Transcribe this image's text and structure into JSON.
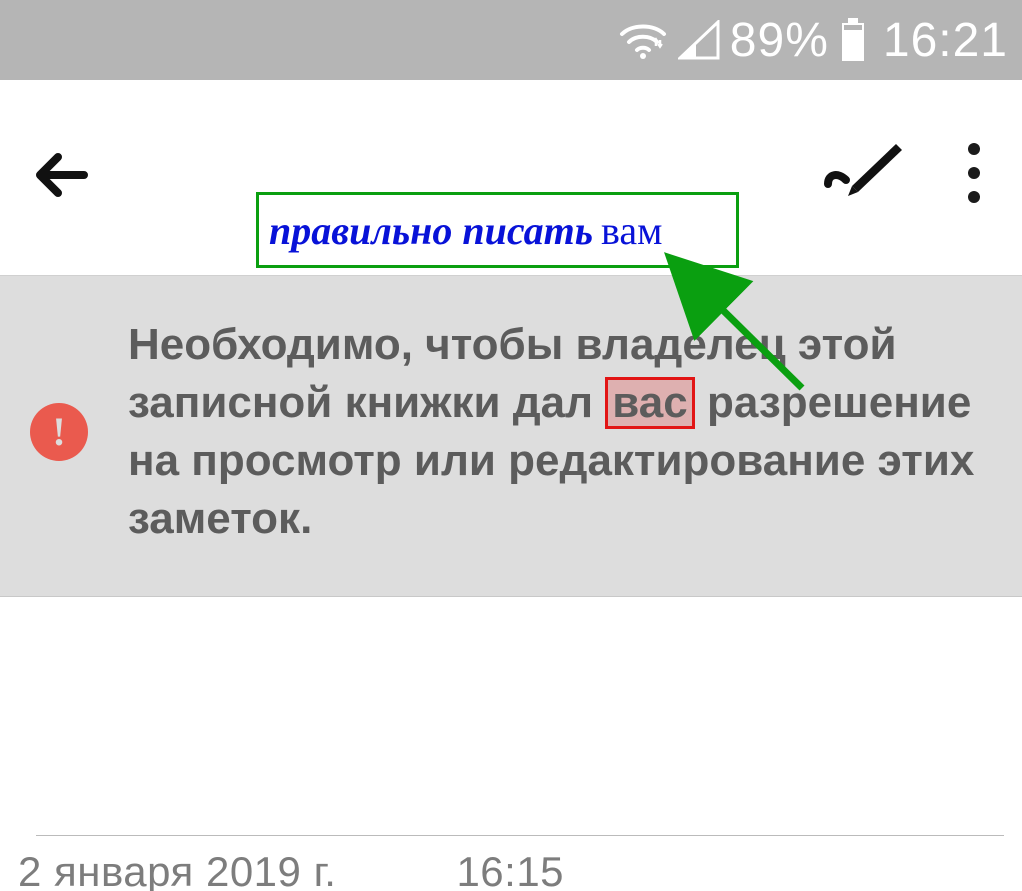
{
  "statusbar": {
    "battery_pct": "89%",
    "clock": "16:21"
  },
  "annotation": {
    "prefix_italic": "правильно писать",
    "correct_word": "вам"
  },
  "banner": {
    "text_before": "Необходимо, чтобы владелец этой записной книжки дал ",
    "wrong_word": "вас",
    "text_after": " разрешение на просмотр или редактирование этих заметок."
  },
  "note": {
    "date": "2 января 2019 г.",
    "time": "16:15"
  },
  "colors": {
    "annotation_border": "#0a9f10",
    "annotation_text": "#0812d8",
    "error_border": "#e21414",
    "warn_bg": "#ea5a4e"
  }
}
